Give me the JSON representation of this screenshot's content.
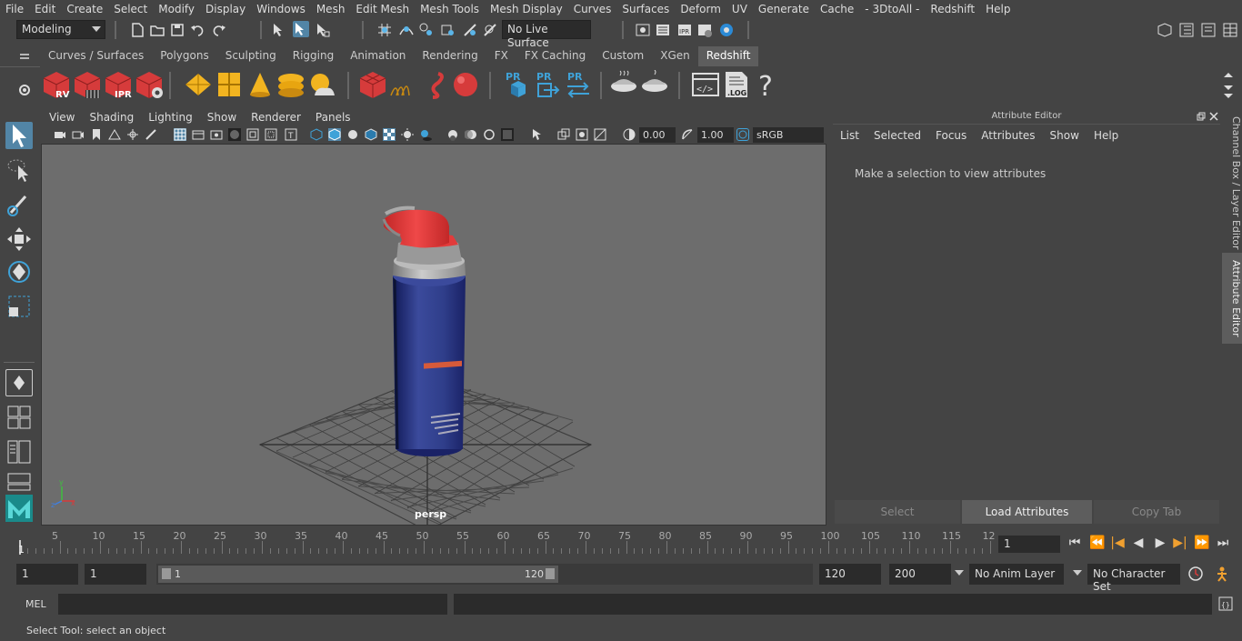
{
  "menubar": {
    "items": [
      "File",
      "Edit",
      "Create",
      "Select",
      "Modify",
      "Display",
      "Windows",
      "Mesh",
      "Edit Mesh",
      "Mesh Tools",
      "Mesh Display",
      "Curves",
      "Surfaces",
      "Deform",
      "UV",
      "Generate",
      "Cache",
      "- 3DtoAll -",
      "Redshift",
      "Help"
    ]
  },
  "statusline": {
    "mode": "Modeling",
    "live_surface": "No Live Surface"
  },
  "shelf": {
    "tabs": [
      "Curves / Surfaces",
      "Polygons",
      "Sculpting",
      "Rigging",
      "Animation",
      "Rendering",
      "FX",
      "FX Caching",
      "Custom",
      "XGen",
      "Redshift"
    ],
    "active_tab": "Redshift",
    "icons": {
      "rv": "RV",
      "ipr": "IPR",
      "pr": "PR",
      "log": ".LOG",
      "help": "?"
    }
  },
  "viewport": {
    "menu": [
      "View",
      "Shading",
      "Lighting",
      "Show",
      "Renderer",
      "Panels"
    ],
    "exposure": "0.00",
    "gamma": "1.00",
    "color_space": "sRGB gamma",
    "camera": "persp"
  },
  "attribute_editor": {
    "title": "Attribute Editor",
    "menu": [
      "List",
      "Selected",
      "Focus",
      "Attributes",
      "Show",
      "Help"
    ],
    "message": "Make a selection to view attributes",
    "buttons": {
      "select": "Select",
      "load": "Load Attributes",
      "copy": "Copy Tab"
    }
  },
  "side_tabs": {
    "channel_box": "Channel Box / Layer Editor",
    "attribute_editor": "Attribute Editor"
  },
  "timeline": {
    "ticks": [
      "1",
      "5",
      "10",
      "15",
      "20",
      "25",
      "30",
      "35",
      "40",
      "45",
      "50",
      "55",
      "60",
      "65",
      "70",
      "75",
      "80",
      "85",
      "90",
      "95",
      "100",
      "105",
      "110",
      "115",
      "12"
    ],
    "current_frame": "1"
  },
  "range": {
    "start": "1",
    "playback_start": "1",
    "slider_start": "1",
    "slider_end": "120",
    "playback_end": "120",
    "end": "200",
    "anim_layer": "No Anim Layer",
    "character_set": "No Character Set"
  },
  "command": {
    "language": "MEL"
  },
  "help_line": "Select Tool: select an object",
  "colors": {
    "bg": "#444444",
    "field": "#2b2b2b",
    "viewport": "#6d6d6d",
    "accent_red": "#d63b3b",
    "accent_yellow": "#f2b420",
    "accent_blue": "#3fa2d8",
    "can_blue": "#2a3a8a",
    "can_cap": "#e23b3b"
  }
}
